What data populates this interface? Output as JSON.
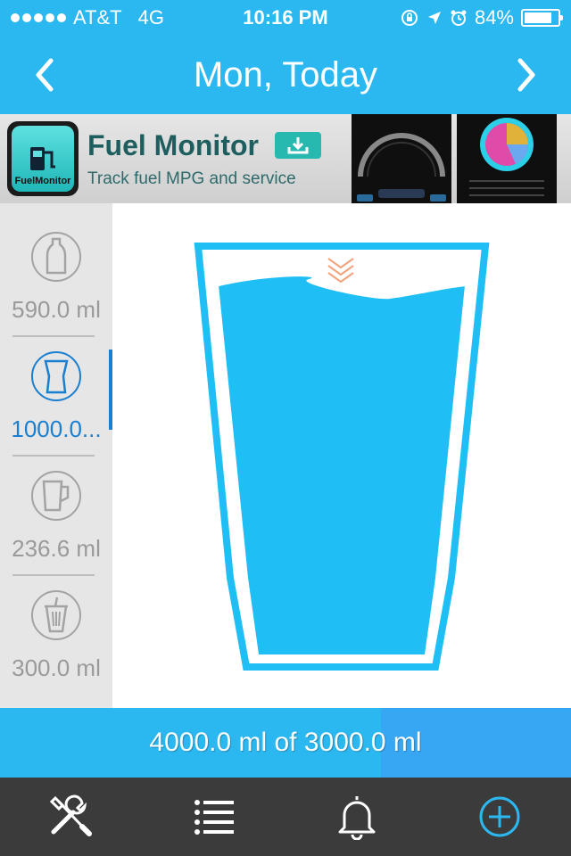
{
  "status_bar": {
    "carrier": "AT&T",
    "network": "4G",
    "time": "10:16 PM",
    "battery": "84%",
    "battery_level": 0.84
  },
  "nav": {
    "title": "Mon, Today",
    "prev_icon": "chevron-left-icon",
    "next_icon": "chevron-right-icon"
  },
  "ad": {
    "app_name": "Fuel Monitor",
    "tagline": "Track fuel MPG and service",
    "logo_text": "FuelMonitor",
    "download_icon": "download-icon"
  },
  "sidebar": {
    "items": [
      {
        "icon": "bottle-icon",
        "label": "590.0 ml",
        "active": false
      },
      {
        "icon": "glass-icon",
        "label": "1000.0...",
        "active": true
      },
      {
        "icon": "mug-icon",
        "label": "236.6 ml",
        "active": false
      },
      {
        "icon": "cup-with-straw-icon",
        "label": "300.0 ml",
        "active": false
      }
    ]
  },
  "glass": {
    "fill_fraction": 0.93,
    "water_color": "#1fbff5",
    "outline_color": "#1fbff5",
    "drag_icon": "double-chevron-down-icon"
  },
  "progress": {
    "text": "4000.0 ml of 3000.0 ml",
    "fraction": 0.667
  },
  "tab_bar": {
    "items": [
      {
        "icon": "tools-icon"
      },
      {
        "icon": "list-icon"
      },
      {
        "icon": "bell-icon"
      },
      {
        "icon": "add-circle-icon"
      }
    ]
  },
  "colors": {
    "accent": "#2bb8f0",
    "active": "#1a7fd0",
    "tab_bar": "#3b3b3b"
  }
}
